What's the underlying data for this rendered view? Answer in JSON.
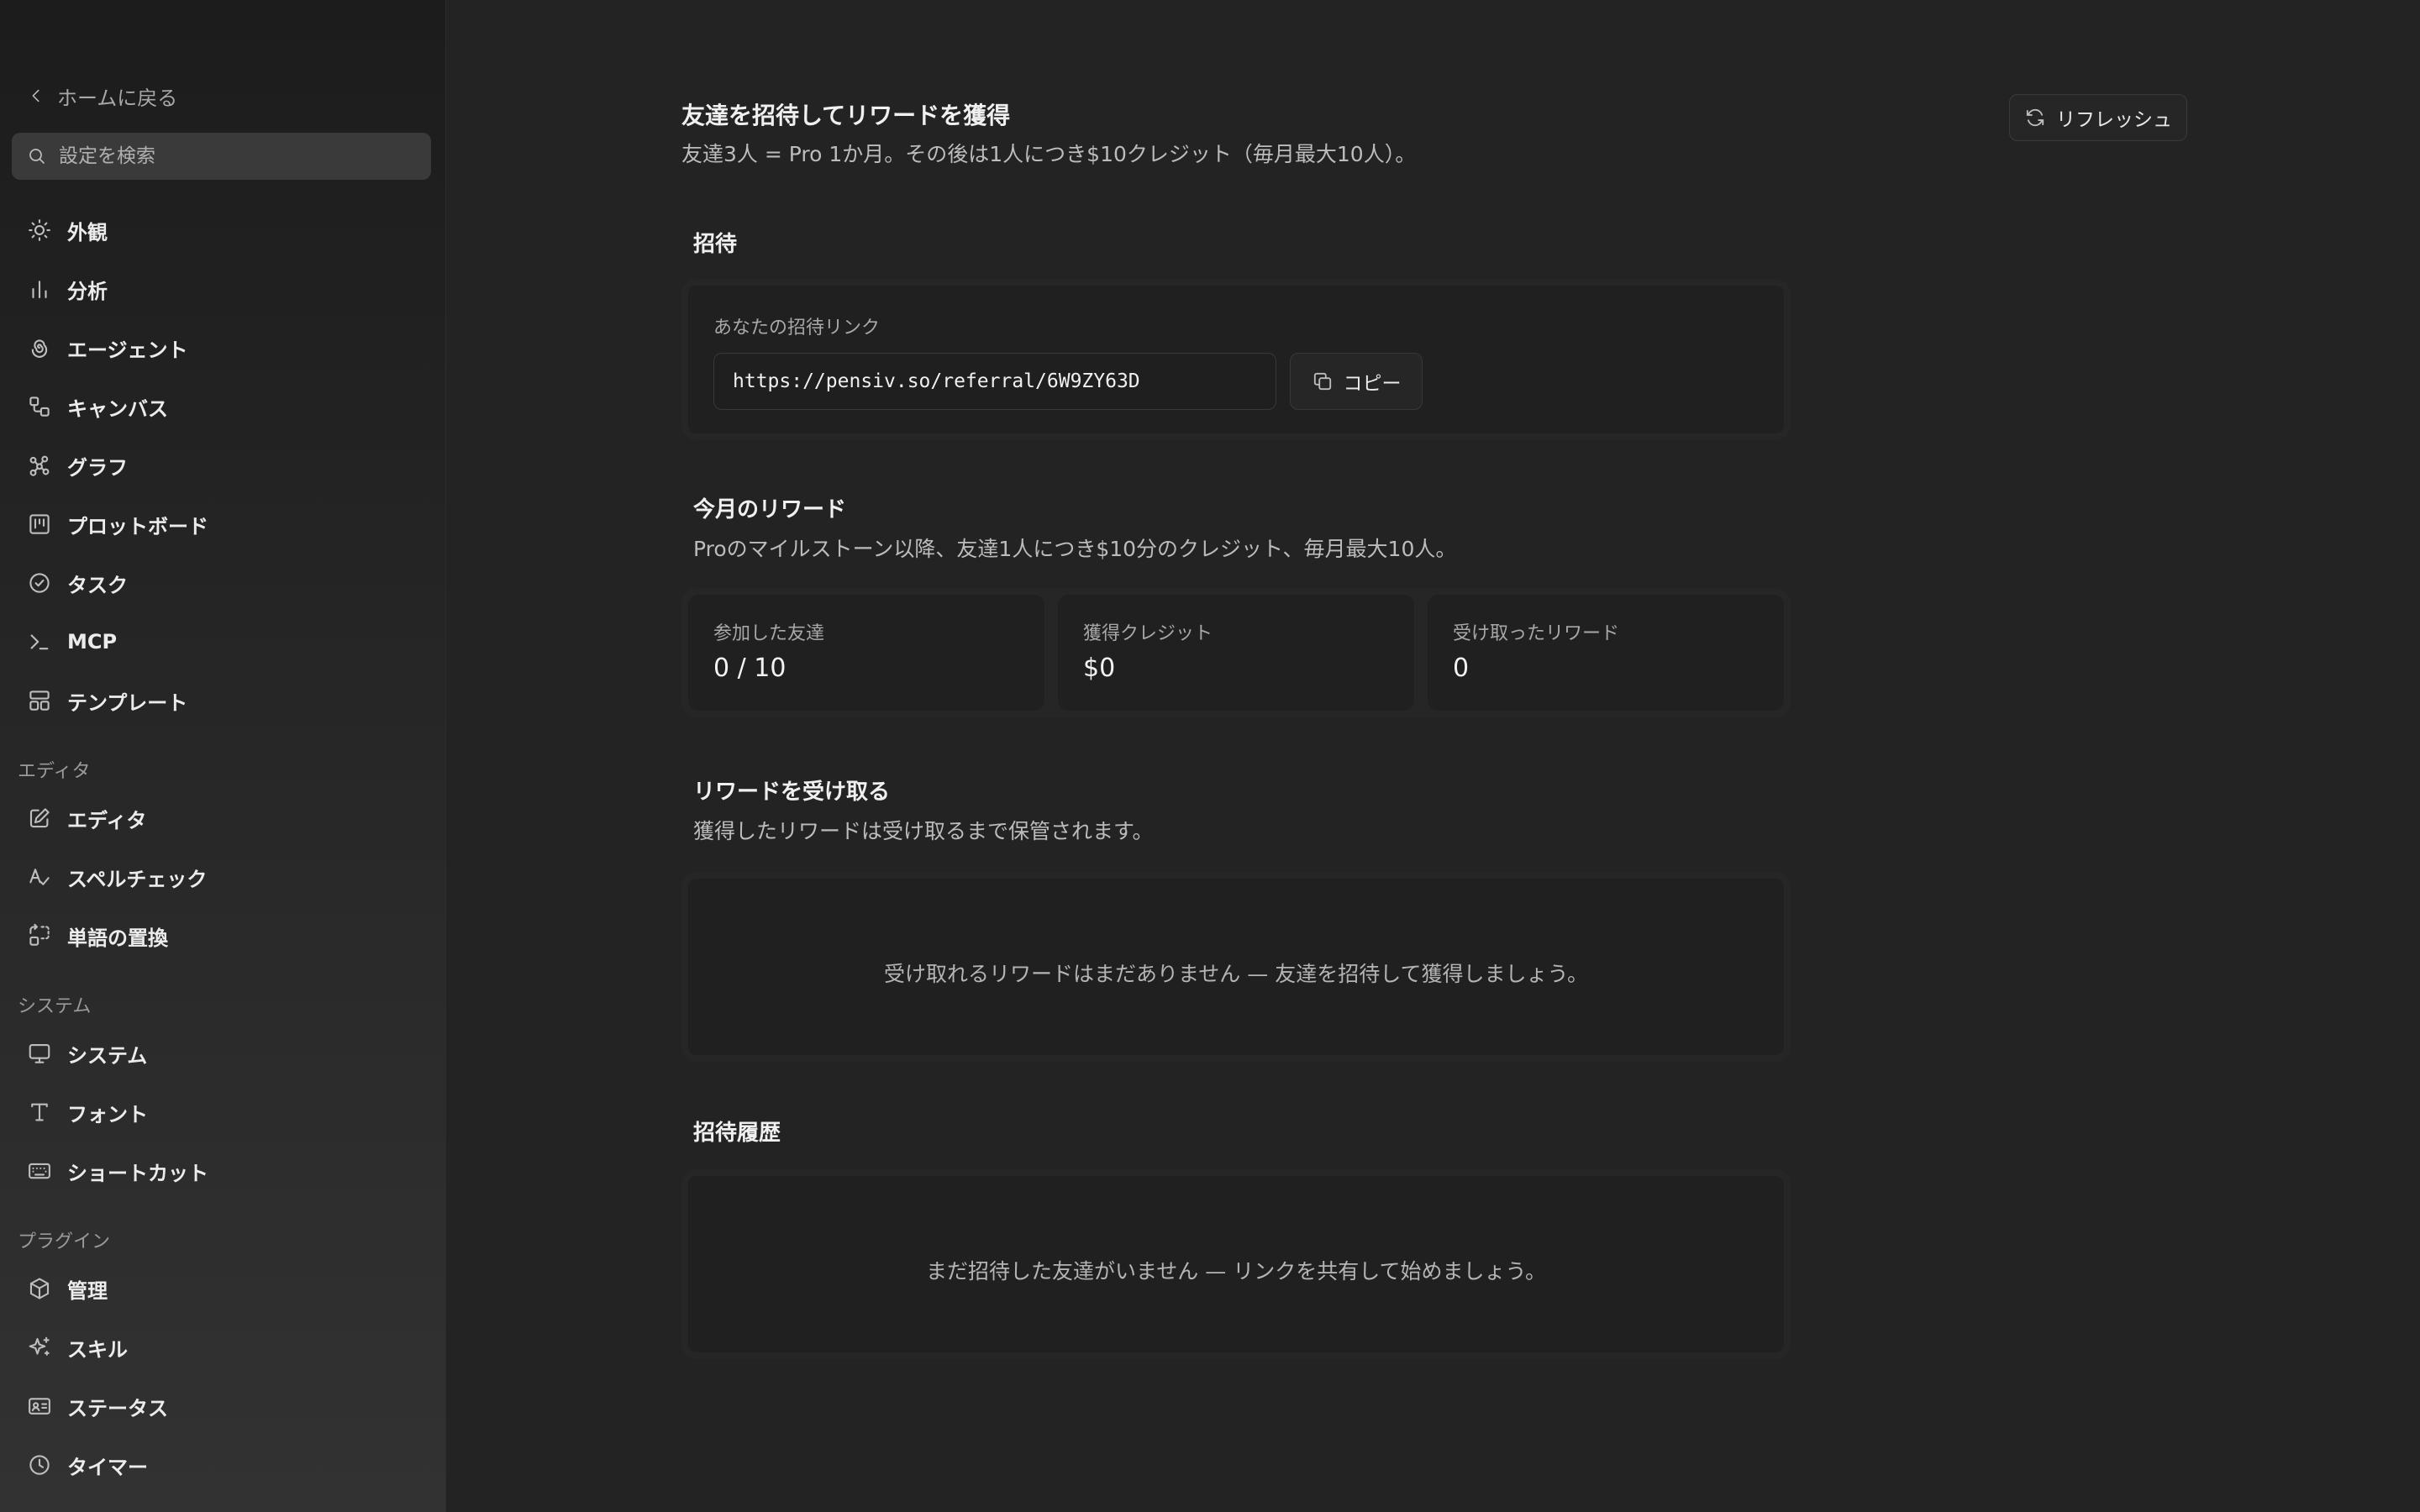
{
  "sidebar": {
    "back_label": "ホームに戻る",
    "search_placeholder": "設定を検索",
    "groups": [
      {
        "label": "",
        "items": [
          {
            "label": "外観",
            "icon": "sun-icon"
          },
          {
            "label": "分析",
            "icon": "bar-chart-icon"
          },
          {
            "label": "エージェント",
            "icon": "spiral-icon"
          },
          {
            "label": "キャンバス",
            "icon": "canvas-icon"
          },
          {
            "label": "グラフ",
            "icon": "graph-icon"
          },
          {
            "label": "プロットボード",
            "icon": "kanban-icon"
          },
          {
            "label": "タスク",
            "icon": "check-circle-icon"
          },
          {
            "label": "MCP",
            "icon": "terminal-icon"
          },
          {
            "label": "テンプレート",
            "icon": "template-icon"
          }
        ]
      },
      {
        "label": "エディタ",
        "items": [
          {
            "label": "エディタ",
            "icon": "edit-icon"
          },
          {
            "label": "スペルチェック",
            "icon": "spellcheck-icon"
          },
          {
            "label": "単語の置換",
            "icon": "replace-icon"
          }
        ]
      },
      {
        "label": "システム",
        "items": [
          {
            "label": "システム",
            "icon": "monitor-icon"
          },
          {
            "label": "フォント",
            "icon": "type-icon"
          },
          {
            "label": "ショートカット",
            "icon": "keyboard-icon"
          }
        ]
      },
      {
        "label": "プラグイン",
        "items": [
          {
            "label": "管理",
            "icon": "box-icon"
          },
          {
            "label": "スキル",
            "icon": "sparkle-icon"
          },
          {
            "label": "ステータス",
            "icon": "id-card-icon"
          },
          {
            "label": "タイマー",
            "icon": "clock-icon"
          }
        ]
      }
    ]
  },
  "header": {
    "title": "友達を招待してリワードを獲得",
    "subtitle": "友達3人 = Pro 1か月。その後は1人につき$10クレジット（毎月最大10人）。",
    "refresh_label": "リフレッシュ"
  },
  "invite": {
    "heading": "招待",
    "link_label": "あなたの招待リンク",
    "link_value": "https://pensiv.so/referral/6W9ZY63D",
    "copy_label": "コピー"
  },
  "monthly": {
    "heading": "今月のリワード",
    "description": "Proのマイルストーン以降、友達1人につき$10分のクレジット、毎月最大10人。",
    "stats": [
      {
        "label": "参加した友達",
        "value": "0 / 10"
      },
      {
        "label": "獲得クレジット",
        "value": "$0"
      },
      {
        "label": "受け取ったリワード",
        "value": "0"
      }
    ]
  },
  "claim": {
    "heading": "リワードを受け取る",
    "description": "獲得したリワードは受け取るまで保管されます。",
    "empty_message": "受け取れるリワードはまだありません — 友達を招待して獲得しましょう。"
  },
  "history": {
    "heading": "招待履歴",
    "empty_message": "まだ招待した友達がいません — リンクを共有して始めましょう。"
  }
}
